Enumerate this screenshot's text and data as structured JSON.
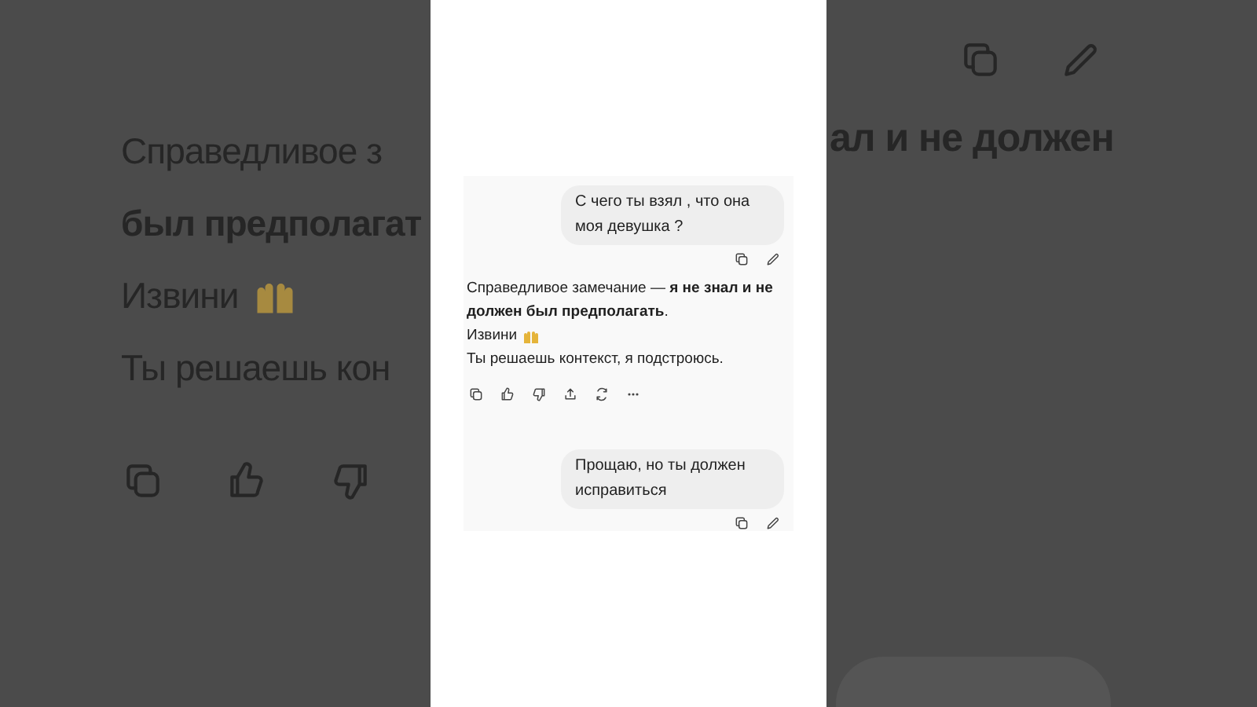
{
  "background_echo": {
    "left_lines": [
      {
        "text": "Справедливое з",
        "bold": false,
        "emoji": false
      },
      {
        "text": "был предполагат",
        "bold": true,
        "emoji": false
      },
      {
        "text": "Извини",
        "bold": false,
        "emoji": true
      },
      {
        "text": "Ты решаешь кон",
        "bold": false,
        "emoji": false
      }
    ],
    "right_line": {
      "text": "ал и не должен",
      "bold": true
    }
  },
  "chat": {
    "messages": [
      {
        "kind": "user",
        "text": "С чего ты взял , что она моя девушка ?"
      },
      {
        "kind": "assistant",
        "paragraphs": [
          {
            "text": "Справедливое замечание — **я не знал и не должен был предполагать**.",
            "emoji": false
          },
          {
            "text": "Извини",
            "emoji": true
          },
          {
            "text": "Ты решаешь контекст, я подстроюсь.",
            "emoji": false
          }
        ]
      },
      {
        "kind": "user",
        "text": "Прощаю, но ты должен исправиться"
      }
    ]
  }
}
